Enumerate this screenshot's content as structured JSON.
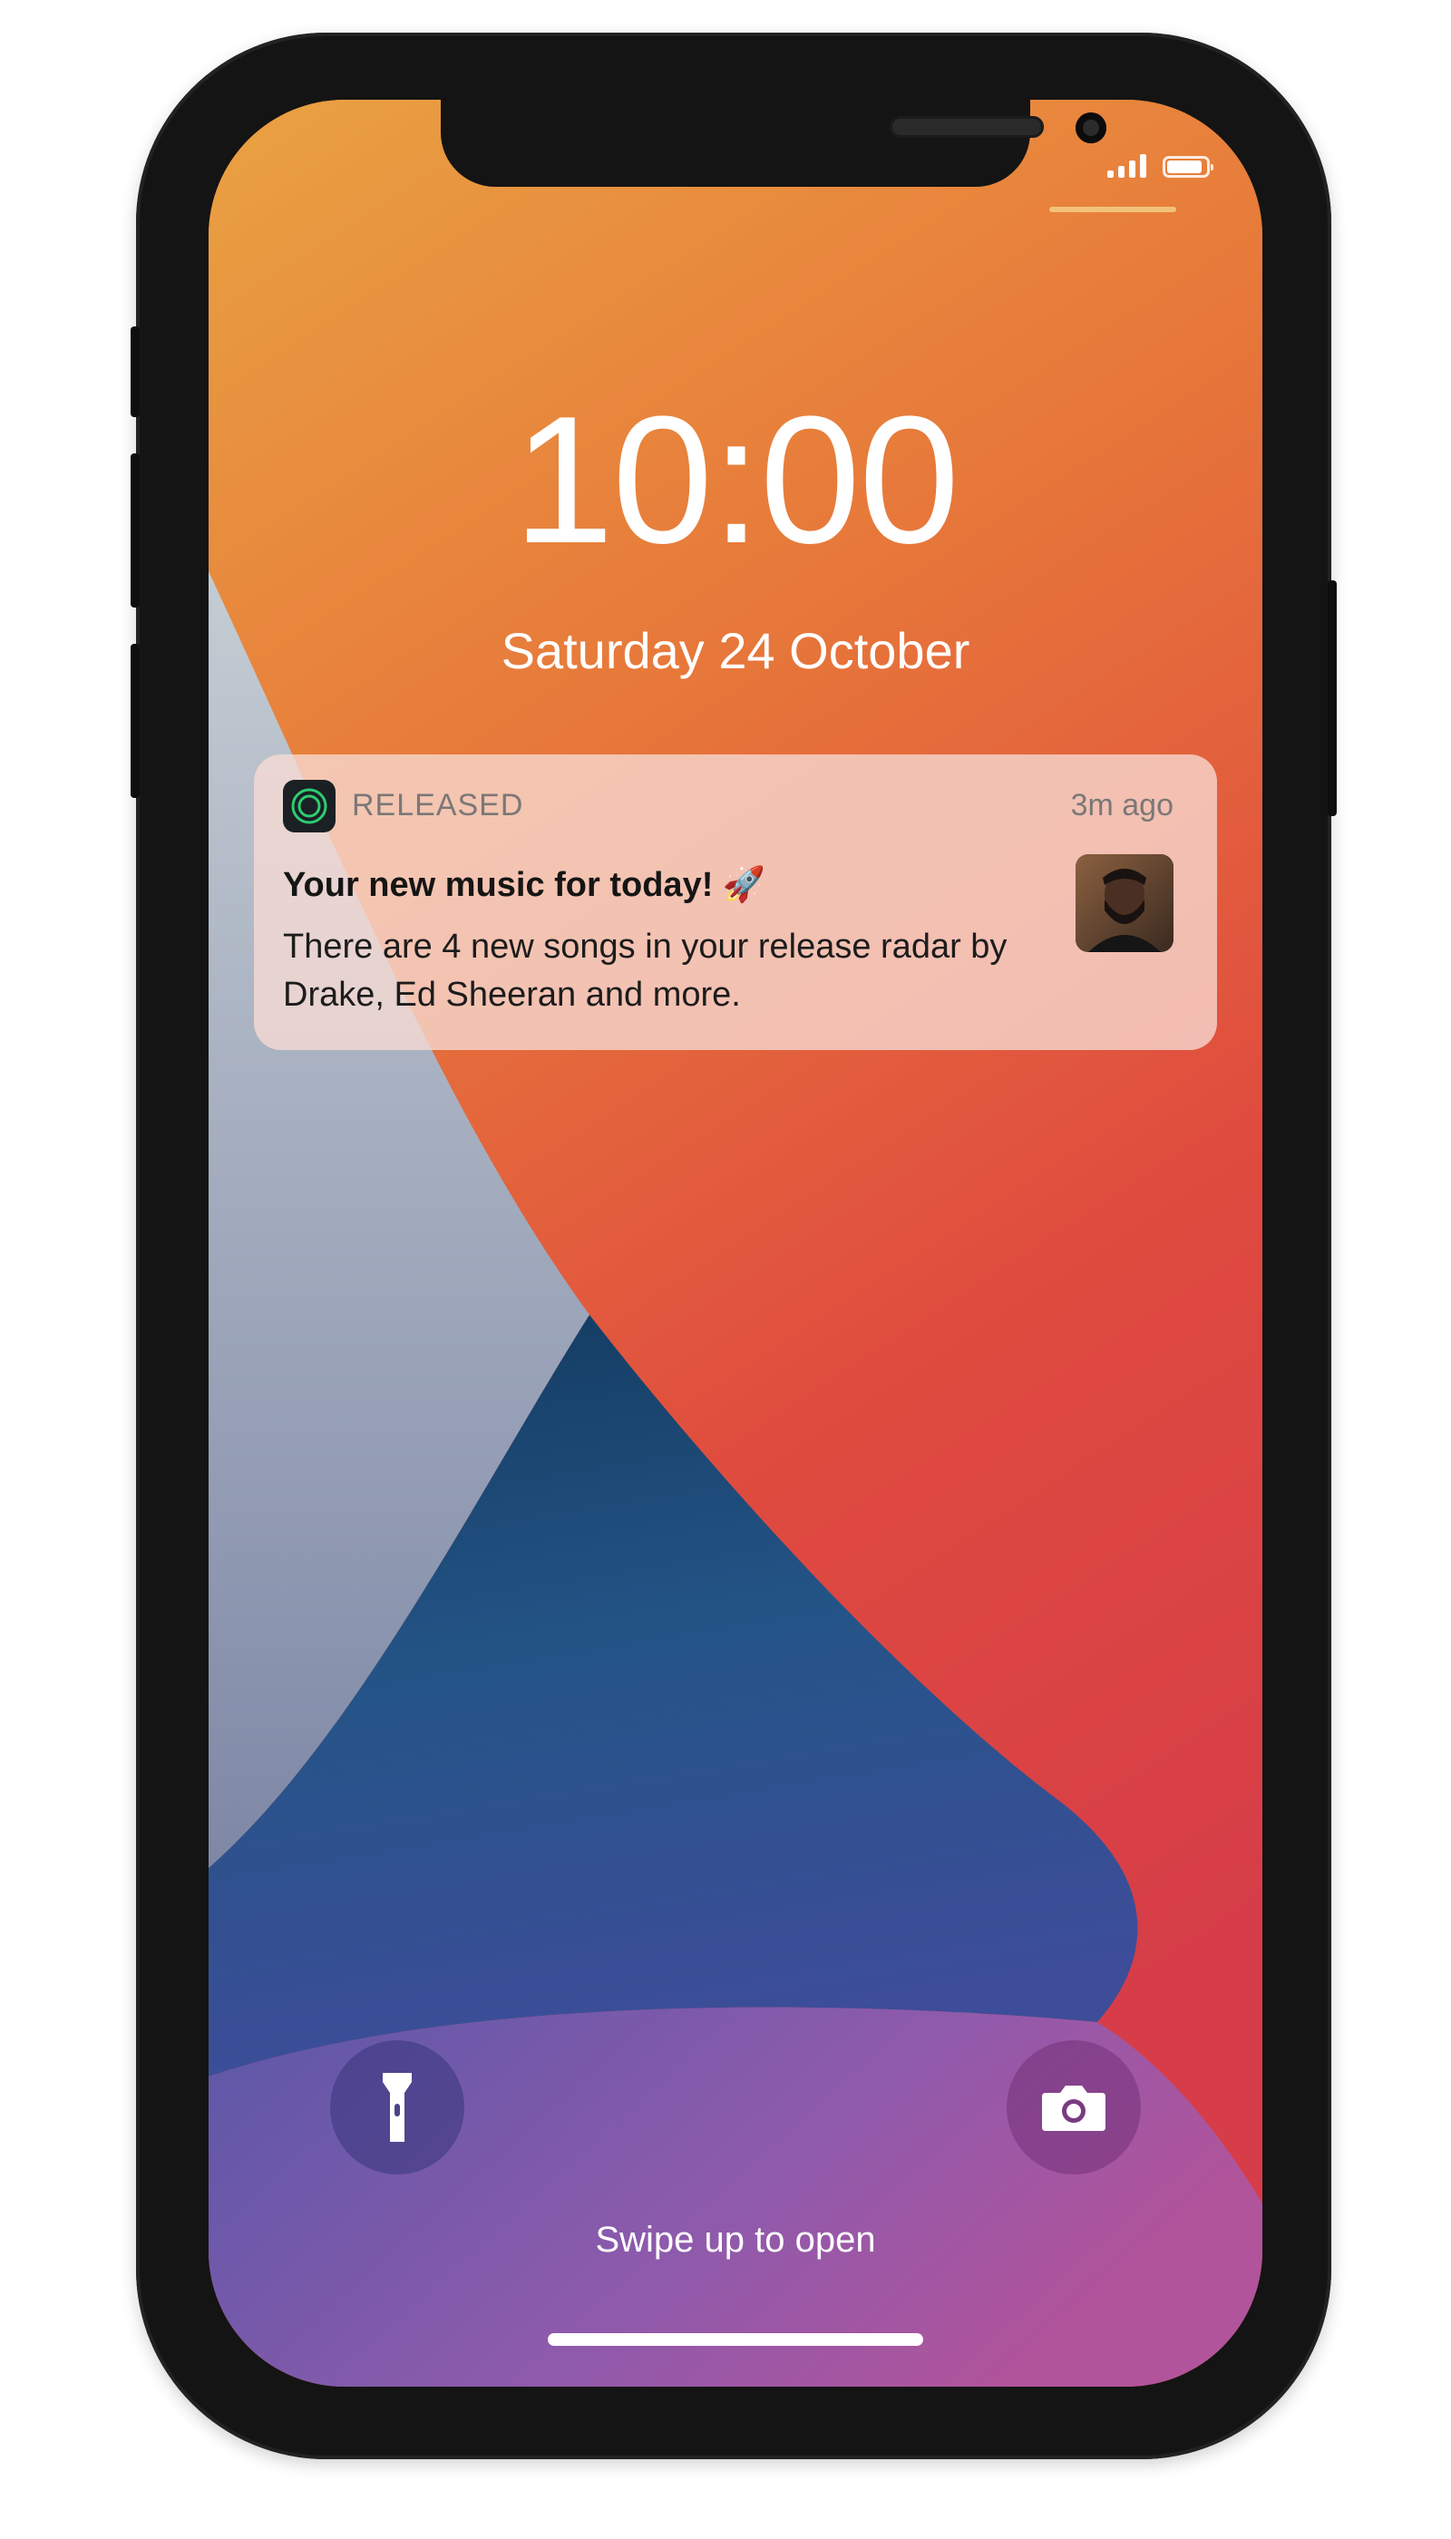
{
  "status_bar": {
    "signal_icon": "cellular-signal-icon",
    "battery_icon": "battery-icon"
  },
  "lock_screen": {
    "time": "10:00",
    "date": "Saturday 24 October"
  },
  "notification": {
    "app_name": "RELEASED",
    "app_icon": "released-app-icon",
    "age": "3m ago",
    "title": "Your new music for today! 🚀",
    "body": "There are 4 new songs in your release radar by Drake, Ed Sheeran and more.",
    "thumbnail": "artist-photo"
  },
  "controls": {
    "flashlight_icon": "flashlight-icon",
    "camera_icon": "camera-icon",
    "swipe_hint": "Swipe up to open"
  },
  "colors": {
    "wallpaper_orange": "#e8863a",
    "wallpaper_red": "#d9413d",
    "wallpaper_blue": "#1f4f7c",
    "wallpaper_purple": "#9a5aa8",
    "app_accent_green": "#2ecc71"
  }
}
